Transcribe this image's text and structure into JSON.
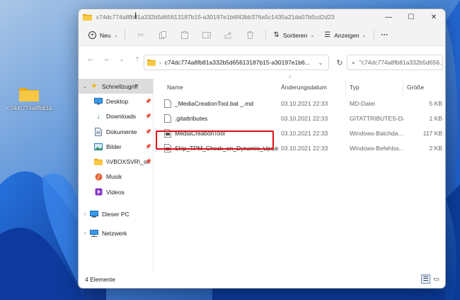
{
  "desktop": {
    "folder_label": "c74dc774a8fb81a33..."
  },
  "window": {
    "title": "c74dc774a8fb81a332b5d65613187b15-a30197e1b6f43bb376a5c1435a21da07b5cd2d23",
    "controls": {
      "minimize": "—",
      "maximize": "☐",
      "close": "✕"
    }
  },
  "toolbar": {
    "new_label": "Neu",
    "sort_label": "Sortieren",
    "view_label": "Anzeigen",
    "more_label": "···"
  },
  "address": {
    "path": "c74dc774a8fb81a332b5d65613187b15-a30197e1b6...",
    "search_placeholder": "\"c74dc774a8fb81a332b5d656..."
  },
  "sidebar": {
    "items": [
      {
        "label": "Schnellzugriff",
        "icon": "star-icon",
        "pinned": false
      },
      {
        "label": "Desktop",
        "icon": "desktop-icon",
        "pinned": true
      },
      {
        "label": "Downloads",
        "icon": "download-icon",
        "pinned": true
      },
      {
        "label": "Dokumente",
        "icon": "document-icon",
        "pinned": true
      },
      {
        "label": "Bilder",
        "icon": "pictures-icon",
        "pinned": true
      },
      {
        "label": "\\\\VBOXSVR\\_sh",
        "icon": "network-folder-icon",
        "pinned": true
      },
      {
        "label": "Musik",
        "icon": "music-icon",
        "pinned": false
      },
      {
        "label": "Videos",
        "icon": "video-icon",
        "pinned": false
      },
      {
        "label": "Dieser PC",
        "icon": "pc-icon",
        "pinned": false
      },
      {
        "label": "Netzwerk",
        "icon": "network-icon",
        "pinned": false
      }
    ]
  },
  "columns": {
    "name": "Name",
    "date": "Änderungsdatum",
    "type": "Typ",
    "size": "Größe"
  },
  "files": [
    {
      "name": "_MediaCreationTool.bat _.md",
      "date": "03.10.2021 22:33",
      "type": "MD-Datei",
      "size": "5 KB"
    },
    {
      "name": ".gitattributes",
      "date": "03.10.2021 22:33",
      "type": "GITATTRIBUTES-Da...",
      "size": "1 KB"
    },
    {
      "name": "MediaCreationTool",
      "date": "03.10.2021 22:33",
      "type": "Windows-Batchda...",
      "size": "117 KB"
    },
    {
      "name": "Skip_TPM_Check_on_Dynamic_Update",
      "date": "03.10.2021 22:33",
      "type": "Windows-Befehlss...",
      "size": "2 KB"
    }
  ],
  "status": {
    "count": "4 Elemente"
  },
  "colors": {
    "highlight": "#e01010",
    "selected_sidebar": "#dcdcdc",
    "folder_yellow": "#f5c242"
  }
}
